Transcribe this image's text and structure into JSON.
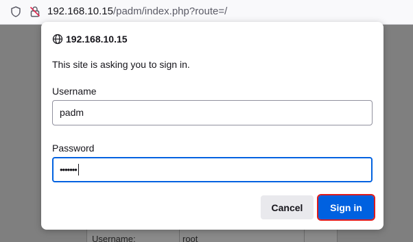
{
  "urlbar": {
    "host": "192.168.10.15",
    "path": "/padm/index.php?route=/",
    "icons": [
      "shield-icon",
      "insecure-lock-icon"
    ]
  },
  "dialog": {
    "host": "192.168.10.15",
    "message": "This site is asking you to sign in.",
    "username_label": "Username",
    "username_value": "padm",
    "password_label": "Password",
    "password_masked": "•••••••",
    "cancel_label": "Cancel",
    "signin_label": "Sign in",
    "icon": "globe-icon"
  },
  "background_page": {
    "label": "Username:",
    "value": "root"
  },
  "colors": {
    "accent": "#0061e0",
    "highlight_outline": "#e01b1b"
  }
}
